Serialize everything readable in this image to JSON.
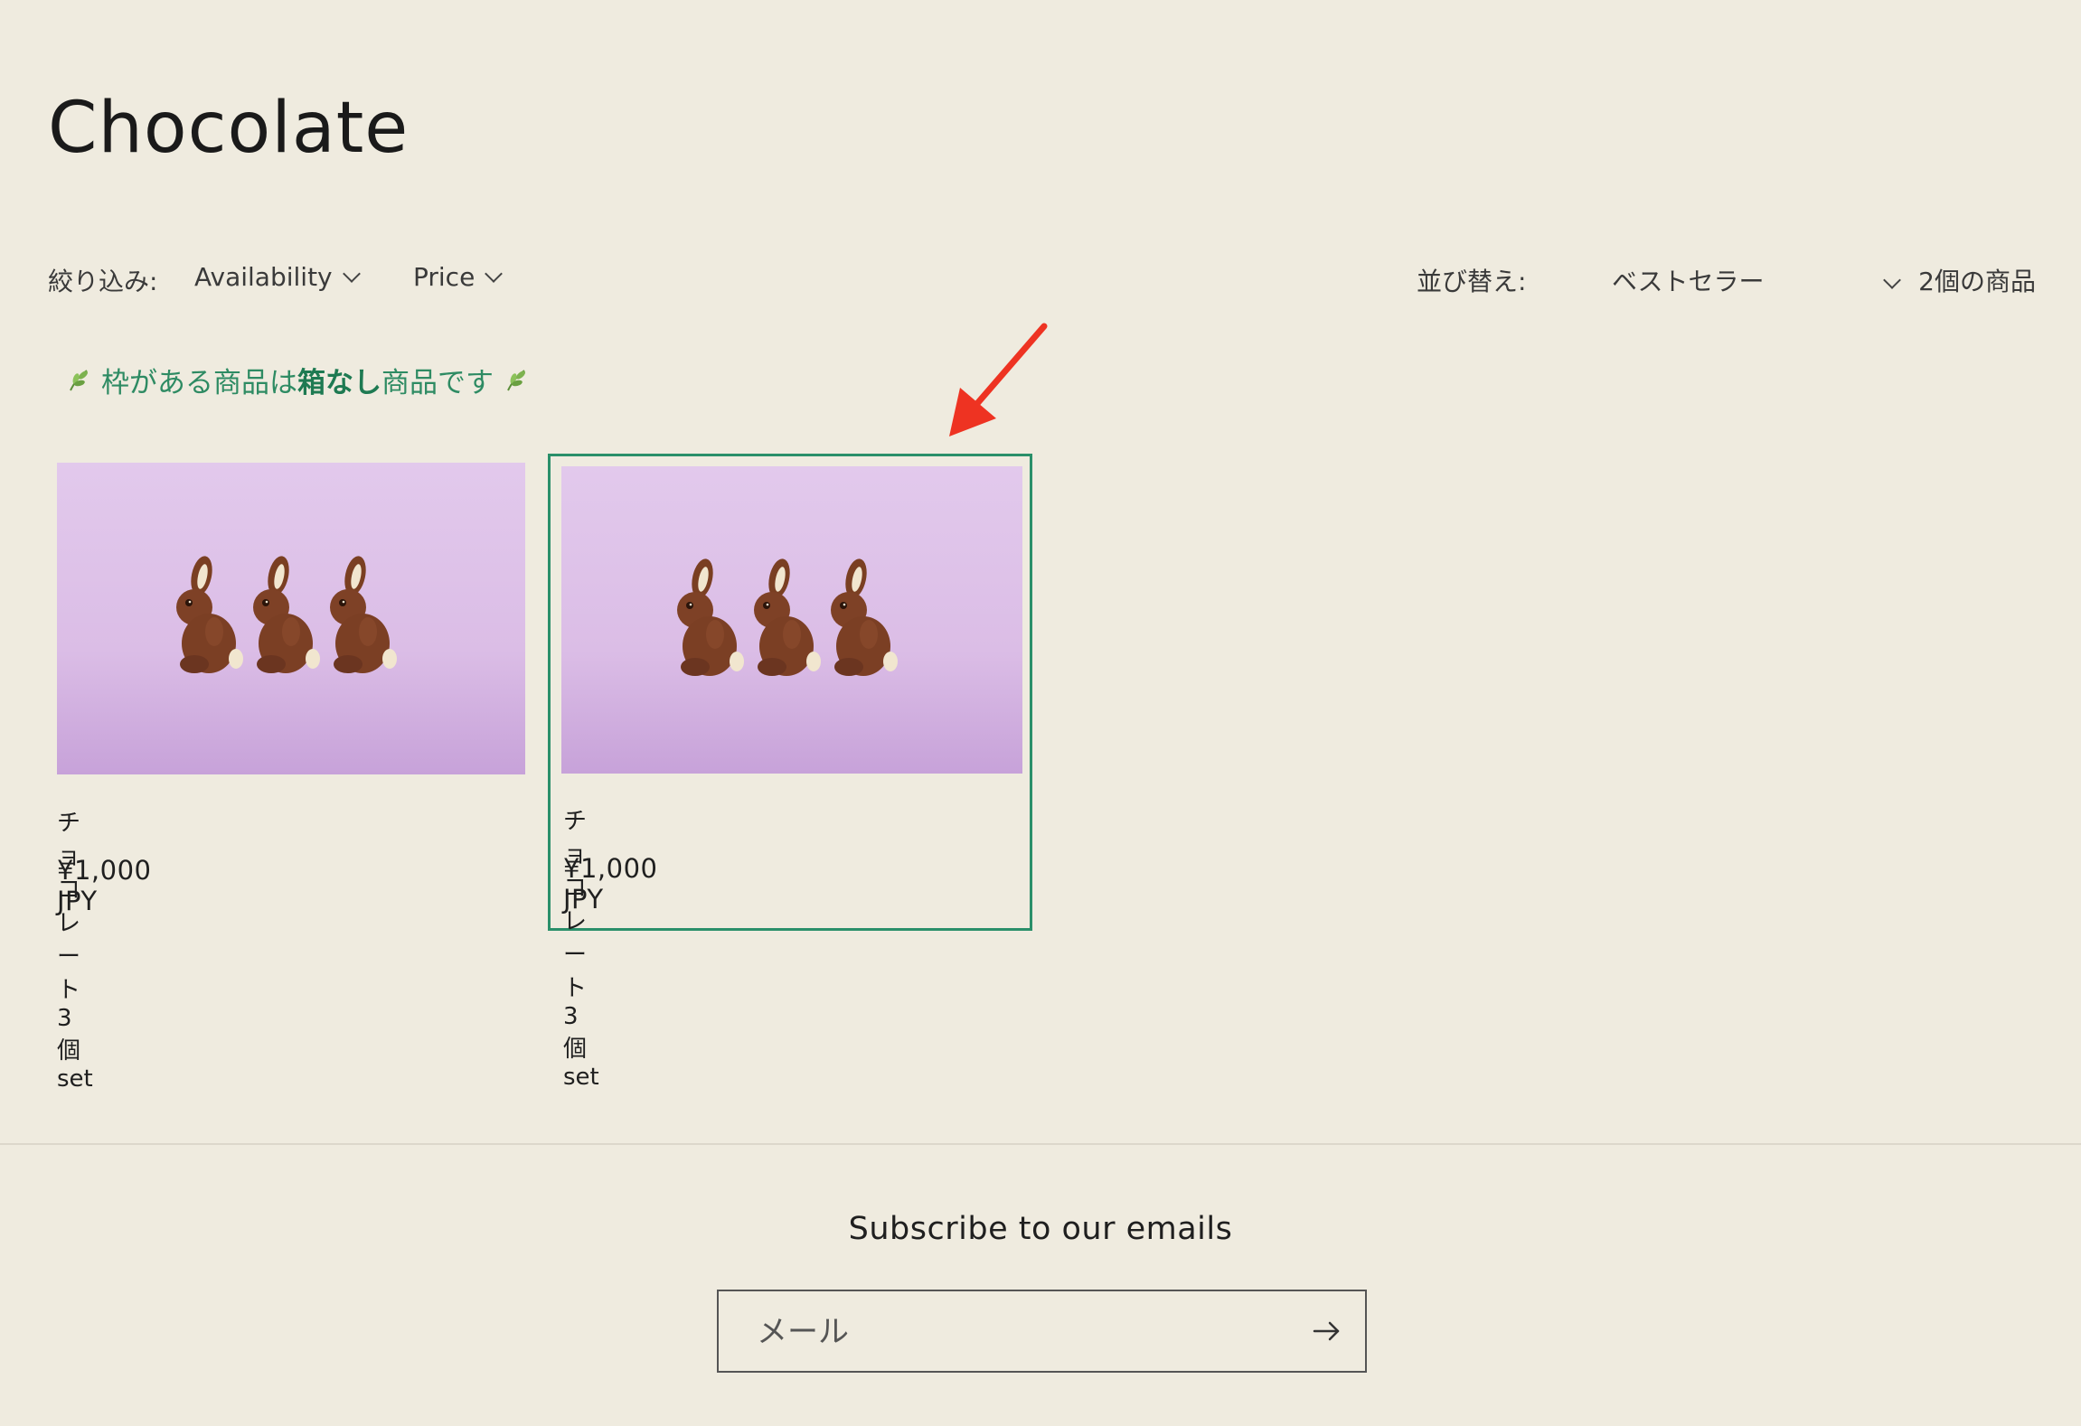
{
  "page": {
    "title": "Chocolate"
  },
  "filters": {
    "label": "絞り込み:",
    "availability": "Availability",
    "price": "Price"
  },
  "sort": {
    "label": "並び替え:",
    "value": "ベストセラー"
  },
  "product_count": "2個の商品",
  "notice": {
    "prefix": "枠がある商品は",
    "bold": "箱なし",
    "suffix": "商品です"
  },
  "products": [
    {
      "title": "チョコレート 3個set",
      "price": "¥1,000 JPY",
      "image": "chocolate-bunnies-image"
    },
    {
      "title": "チョコレート 3個set",
      "price": "¥1,000 JPY",
      "image": "chocolate-bunnies-image",
      "highlighted": true
    }
  ],
  "annotation": {
    "arrow_color": "#ee3322"
  },
  "colors": {
    "background": "#efebdf",
    "accent_green": "#2a8f6a"
  },
  "footer": {
    "subscribe_title": "Subscribe to our emails",
    "email_placeholder": "メール",
    "submit_icon": "arrow-right-icon"
  }
}
